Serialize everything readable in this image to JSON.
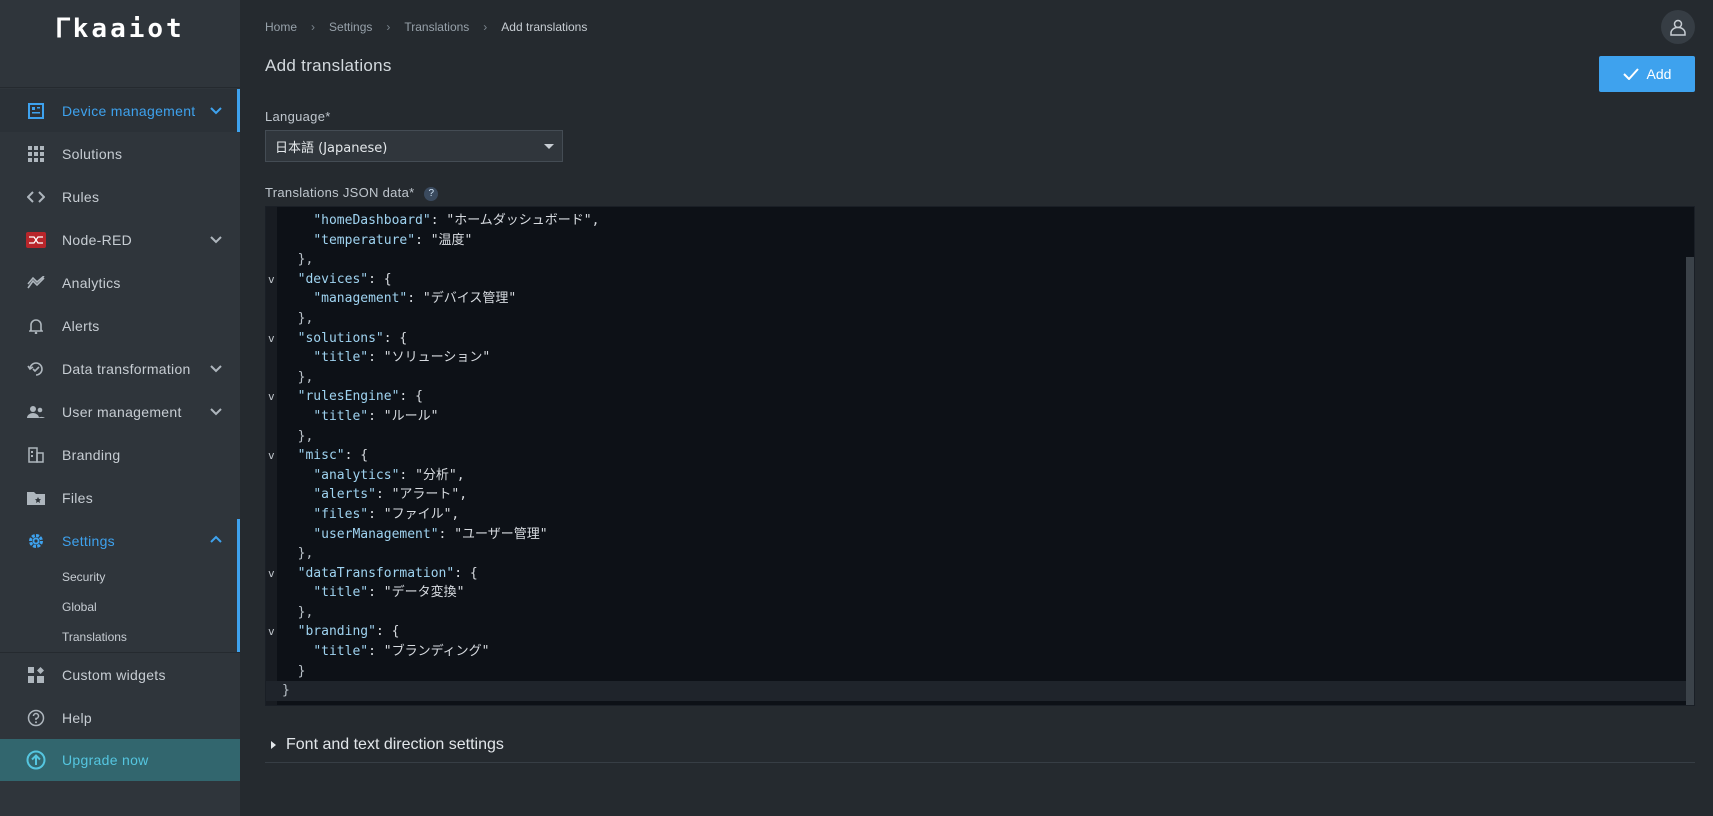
{
  "app": {
    "logo_text": "ᒥkaaiot"
  },
  "sidebar": {
    "items": [
      {
        "label": "Device management",
        "icon": "device-management-icon"
      },
      {
        "label": "Solutions",
        "icon": "grid-icon"
      },
      {
        "label": "Rules",
        "icon": "code-icon"
      },
      {
        "label": "Node-RED",
        "icon": "node-red-icon"
      },
      {
        "label": "Analytics",
        "icon": "analytics-icon"
      },
      {
        "label": "Alerts",
        "icon": "bell-icon"
      },
      {
        "label": "Data transformation",
        "icon": "data-transformation-icon"
      },
      {
        "label": "User management",
        "icon": "users-icon"
      },
      {
        "label": "Branding",
        "icon": "building-icon"
      },
      {
        "label": "Files",
        "icon": "folder-icon"
      },
      {
        "label": "Settings",
        "icon": "gear-icon"
      },
      {
        "label": "Custom widgets",
        "icon": "widgets-icon"
      },
      {
        "label": "Help",
        "icon": "help-icon"
      },
      {
        "label": "Upgrade now",
        "icon": "upgrade-icon"
      }
    ],
    "settings_sub": [
      "Security",
      "Global",
      "Translations"
    ]
  },
  "breadcrumb": [
    "Home",
    "Settings",
    "Translations",
    "Add translations"
  ],
  "page": {
    "title": "Add translations",
    "add_label": "Add",
    "language_label": "Language*",
    "language_value": "日本語 (Japanese)",
    "json_label": "Translations JSON data*",
    "help": "?",
    "font_settings": "Font and text direction settings"
  },
  "editor": {
    "lines": [
      {
        "fold": "",
        "key": "homeDashboard",
        "val": "\"ホームダッシュボード\",",
        "indent": 4
      },
      {
        "fold": "",
        "key": "temperature",
        "val": "\"温度\"",
        "indent": 4
      },
      {
        "fold": "",
        "raw": "},",
        "indent": 2
      },
      {
        "fold": "v",
        "key": "devices",
        "val": "{",
        "indent": 2
      },
      {
        "fold": "",
        "key": "management",
        "val": "\"デバイス管理\"",
        "indent": 4
      },
      {
        "fold": "",
        "raw": "},",
        "indent": 2
      },
      {
        "fold": "v",
        "key": "solutions",
        "val": "{",
        "indent": 2
      },
      {
        "fold": "",
        "key": "title",
        "val": "\"ソリューション\"",
        "indent": 4
      },
      {
        "fold": "",
        "raw": "},",
        "indent": 2
      },
      {
        "fold": "v",
        "key": "rulesEngine",
        "val": "{",
        "indent": 2
      },
      {
        "fold": "",
        "key": "title",
        "val": "\"ルール\"",
        "indent": 4
      },
      {
        "fold": "",
        "raw": "},",
        "indent": 2
      },
      {
        "fold": "v",
        "key": "misc",
        "val": "{",
        "indent": 2
      },
      {
        "fold": "",
        "key": "analytics",
        "val": "\"分析\",",
        "indent": 4
      },
      {
        "fold": "",
        "key": "alerts",
        "val": "\"アラート\",",
        "indent": 4
      },
      {
        "fold": "",
        "key": "files",
        "val": "\"ファイル\",",
        "indent": 4
      },
      {
        "fold": "",
        "key": "userManagement",
        "val": "\"ユーザー管理\"",
        "indent": 4
      },
      {
        "fold": "",
        "raw": "},",
        "indent": 2
      },
      {
        "fold": "v",
        "key": "dataTransformation",
        "val": "{",
        "indent": 2
      },
      {
        "fold": "",
        "key": "title",
        "val": "\"データ変換\"",
        "indent": 4
      },
      {
        "fold": "",
        "raw": "},",
        "indent": 2
      },
      {
        "fold": "v",
        "key": "branding",
        "val": "{",
        "indent": 2
      },
      {
        "fold": "",
        "key": "title",
        "val": "\"ブランディング\"",
        "indent": 4
      },
      {
        "fold": "",
        "raw": "}",
        "indent": 2
      },
      {
        "fold": "",
        "raw": "}",
        "indent": 0,
        "highlight": true
      }
    ]
  },
  "colors": {
    "accent": "#3ea2ee",
    "sidebar": "#2f353b",
    "editor_bg": "#0d1117",
    "upgrade_bg": "#32666e"
  }
}
